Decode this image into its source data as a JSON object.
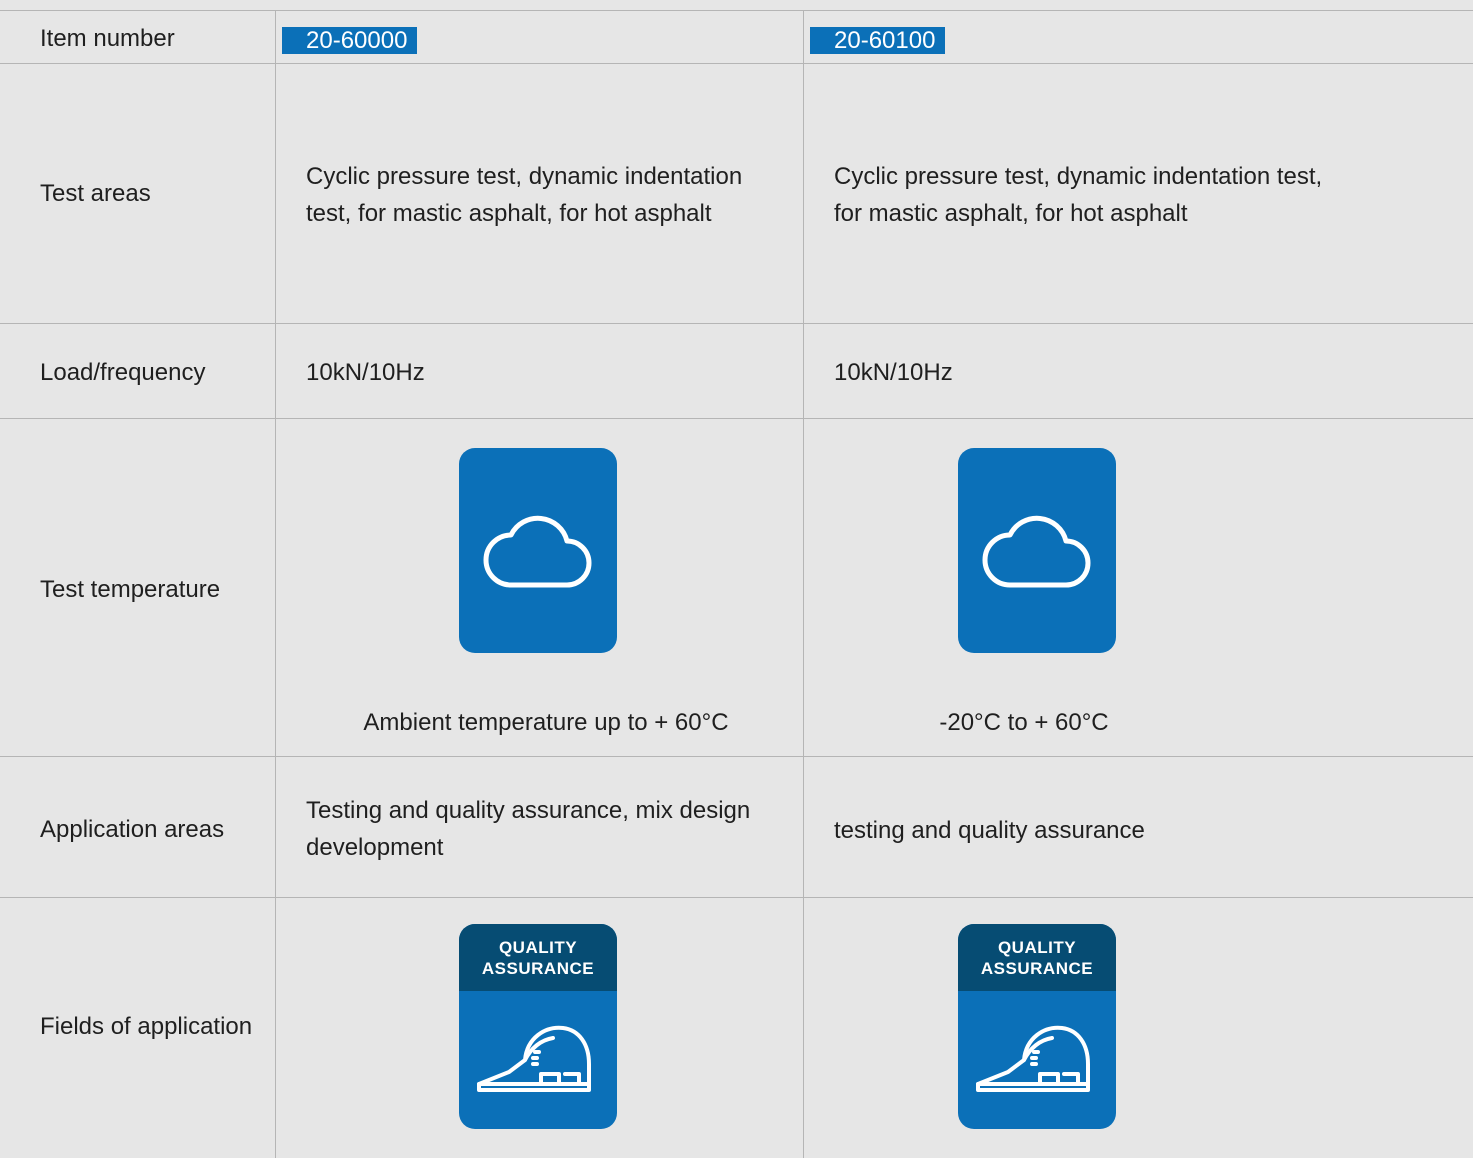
{
  "labels": {
    "item_number": "Item number",
    "test_areas": "Test areas",
    "load_frequency": "Load/frequency",
    "test_temperature": "Test temperature",
    "application_areas": "Application areas",
    "fields_of_application": "Fields of application"
  },
  "products": [
    {
      "item_number": "20-60000",
      "test_areas_line1": "Cyclic pressure test, dynamic indentation",
      "test_areas_line2": "test, for mastic asphalt, for hot asphalt",
      "load_frequency": "10kN/10Hz",
      "temperature_icon": "cloud-icon",
      "temperature_caption": "Ambient temperature up to + 60°C",
      "application_line1": "Testing and quality assurance, mix design",
      "application_line2": "development",
      "field_badge_line1": "QUALITY",
      "field_badge_line2": "ASSURANCE",
      "field_icon": "hard-hat-icon"
    },
    {
      "item_number": "20-60100",
      "test_areas_line1": "Cyclic pressure test, dynamic indentation test,",
      "test_areas_line2": "for mastic asphalt, for hot asphalt",
      "load_frequency": "10kN/10Hz",
      "temperature_icon": "cloud-icon",
      "temperature_caption": "-20°C to + 60°C",
      "application_line1": "testing and quality assurance",
      "field_badge_line1": "QUALITY",
      "field_badge_line2": "ASSURANCE",
      "field_icon": "hard-hat-icon"
    }
  ],
  "colors": {
    "background": "#e6e6e6",
    "accent_blue": "#0b70b8",
    "dark_blue": "#064c73",
    "grid_line": "#b5b5b5"
  }
}
